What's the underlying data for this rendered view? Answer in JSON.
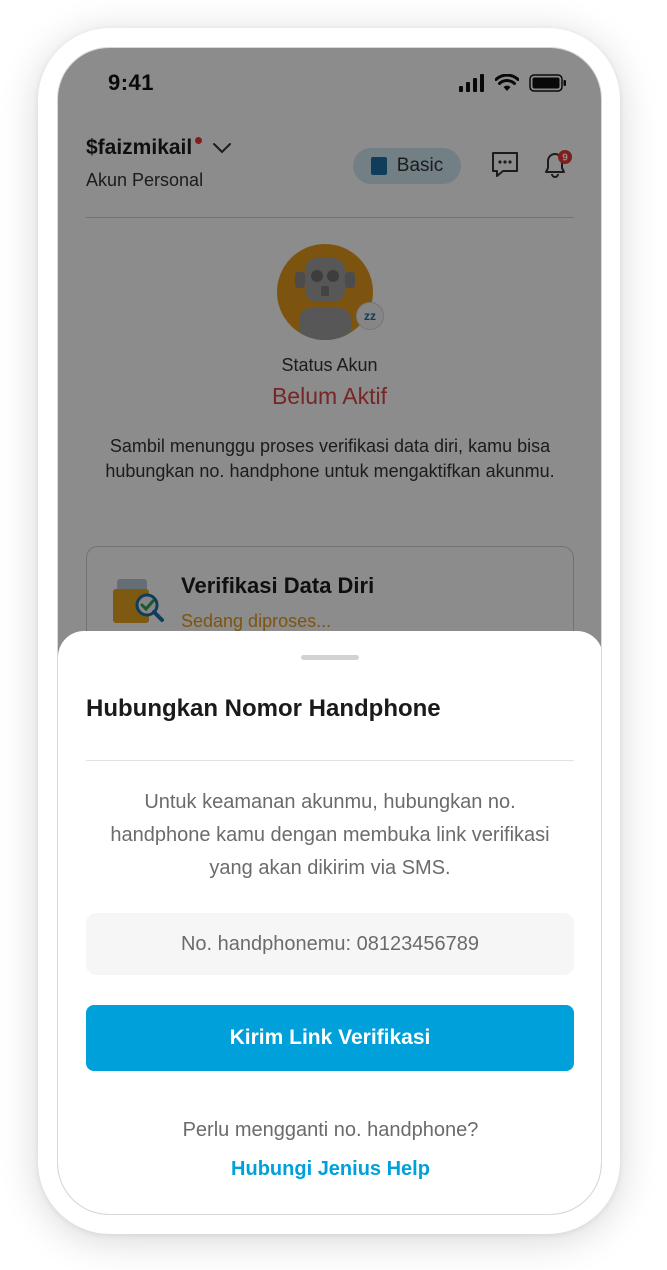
{
  "status_bar": {
    "time": "9:41"
  },
  "header": {
    "username": "$faizmikail",
    "account_type": "Akun Personal",
    "tier_badge": "Basic",
    "notification_count": "9"
  },
  "account_status": {
    "label": "Status Akun",
    "value": "Belum Aktif",
    "info": "Sambil menunggu proses verifikasi data diri, kamu bisa hubungkan no. handphone untuk mengaktifkan akunmu."
  },
  "verification_card": {
    "title": "Verifikasi Data Diri",
    "status": "Sedang diproses..."
  },
  "sheet": {
    "title": "Hubungkan Nomor Handphone",
    "description": "Untuk keamanan akunmu, hubungkan no. handphone kamu dengan membuka link verifikasi yang akan dikirim via SMS.",
    "phone_label": "No. handphonemu: 08123456789",
    "send_button": "Kirim Link Verifikasi",
    "change_question": "Perlu mengganti no. handphone?",
    "help_link": "Hubungi Jenius Help"
  },
  "colors": {
    "primary": "#00a1db",
    "status_inactive": "#d64545",
    "processing": "#e39a1c"
  },
  "icons": [
    "signal-icon",
    "wifi-icon",
    "battery-icon",
    "chevron-down-icon",
    "book-icon",
    "chat-icon",
    "bell-icon",
    "robot-avatar-icon",
    "sleep-icon",
    "id-verification-icon"
  ]
}
